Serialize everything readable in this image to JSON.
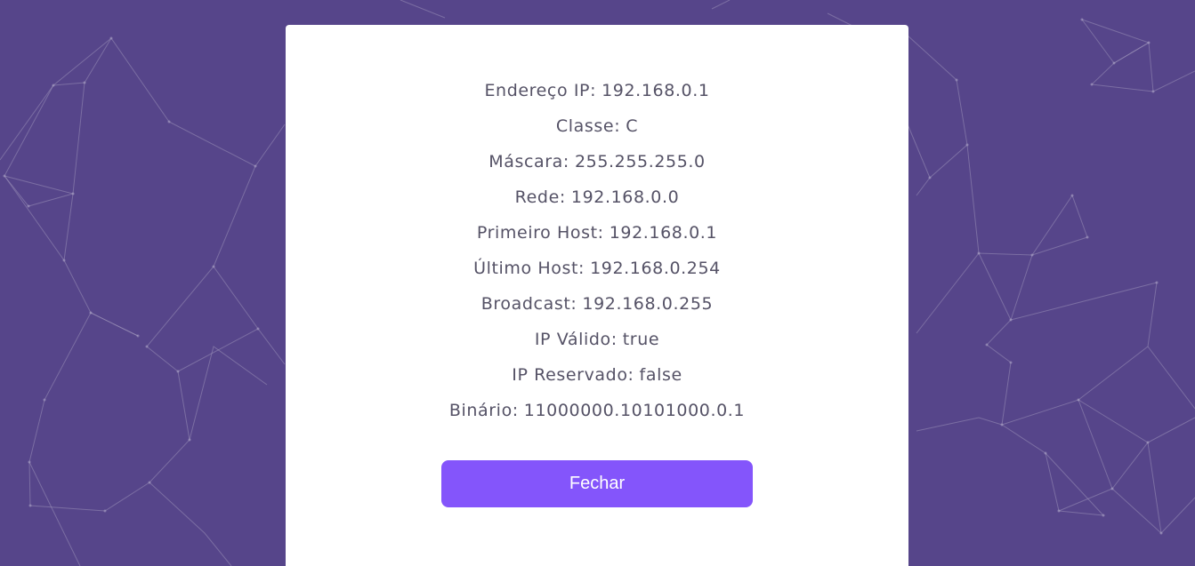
{
  "dialog": {
    "rows": [
      {
        "label": "Endereço IP:",
        "value": "192.168.0.1"
      },
      {
        "label": "Classe:",
        "value": "C"
      },
      {
        "label": "Máscara:",
        "value": "255.255.255.0"
      },
      {
        "label": "Rede:",
        "value": "192.168.0.0"
      },
      {
        "label": "Primeiro Host:",
        "value": "192.168.0.1"
      },
      {
        "label": "Último Host:",
        "value": "192.168.0.254"
      },
      {
        "label": "Broadcast:",
        "value": "192.168.0.255"
      },
      {
        "label": "IP Válido:",
        "value": "true"
      },
      {
        "label": "IP Reservado:",
        "value": "false"
      },
      {
        "label": "Binário:",
        "value": "11000000.10101000.0.1"
      }
    ],
    "close_label": "Fechar"
  },
  "colors": {
    "background": "#56458a",
    "card": "#ffffff",
    "text": "#555266",
    "button": "#8455fb",
    "button_text": "#ffffff"
  }
}
